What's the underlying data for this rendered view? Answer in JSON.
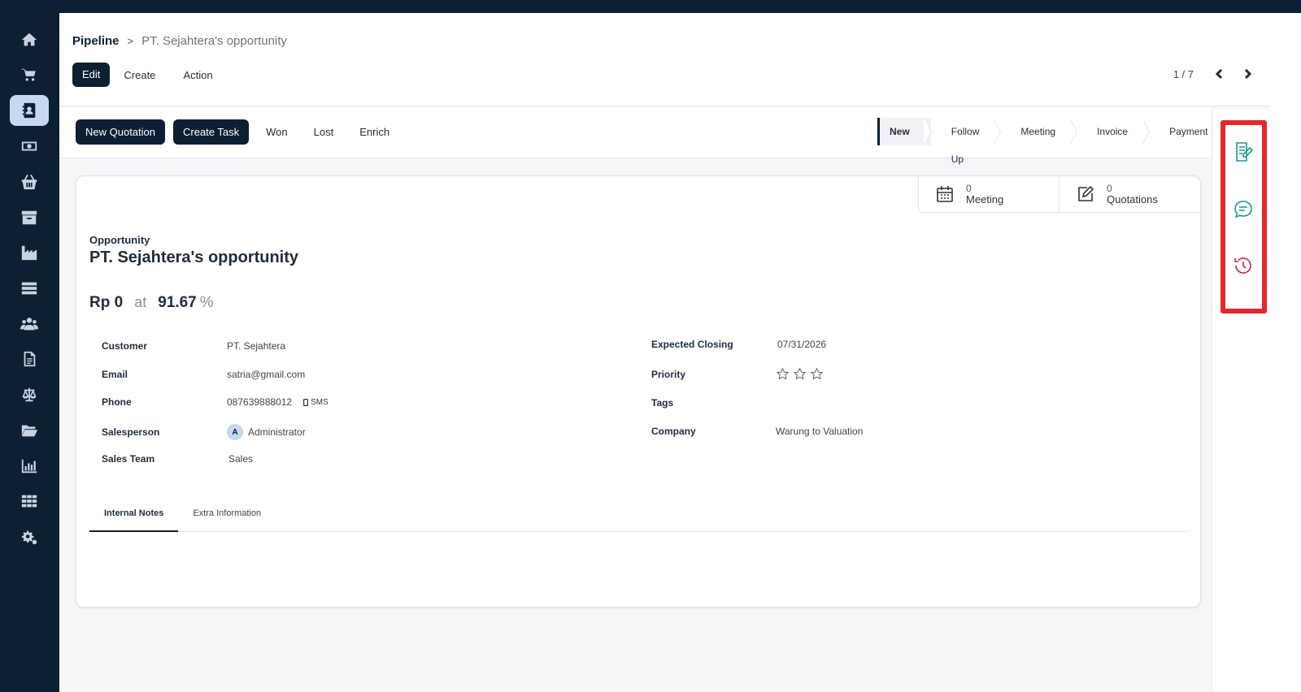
{
  "sidebar": {
    "items": [
      {
        "name": "home-icon"
      },
      {
        "name": "cart-icon"
      },
      {
        "name": "contacts-icon",
        "active": true
      },
      {
        "name": "money-icon"
      },
      {
        "name": "basket-icon"
      },
      {
        "name": "archive-icon"
      },
      {
        "name": "factory-icon"
      },
      {
        "name": "server-icon"
      },
      {
        "name": "users-icon"
      },
      {
        "name": "document-icon"
      },
      {
        "name": "balance-scale-icon"
      },
      {
        "name": "folder-open-icon"
      },
      {
        "name": "bar-chart-icon"
      },
      {
        "name": "apps-grid-icon"
      },
      {
        "name": "settings-gears-icon"
      }
    ]
  },
  "breadcrumb": {
    "root": "Pipeline",
    "separator": ">",
    "current": "PT. Sejahtera's opportunity"
  },
  "control_panel": {
    "edit_label": "Edit",
    "create_label": "Create",
    "action_label": "Action",
    "pager": "1 / 7"
  },
  "status_actions": {
    "new_quotation": "New Quotation",
    "create_task": "Create Task",
    "won": "Won",
    "lost": "Lost",
    "enrich": "Enrich"
  },
  "stages": [
    "New",
    "Follow Up",
    "Meeting",
    "Invoice",
    "Payment"
  ],
  "active_stage": "New",
  "smart_buttons": {
    "meeting": {
      "count": "0",
      "label": "Meeting"
    },
    "quotations": {
      "count": "0",
      "label": "Quotations"
    }
  },
  "form": {
    "type_label": "Opportunity",
    "title": "PT. Sejahtera's opportunity",
    "revenue": "Rp 0",
    "at": "at",
    "probability": "91.67",
    "pct": "%",
    "left": {
      "customer_label": "Customer",
      "customer": "PT. Sejahtera",
      "email_label": "Email",
      "email": "satria@gmail.com",
      "phone_label": "Phone",
      "phone": "087639888012",
      "sms": "SMS",
      "salesperson_label": "Salesperson",
      "salesperson": "Administrator",
      "salesperson_initial": "A",
      "sales_team_label": "Sales Team",
      "sales_team": "Sales"
    },
    "right": {
      "expected_closing_label": "Expected Closing",
      "expected_closing": "07/31/2026",
      "priority_label": "Priority",
      "priority_stars": 0,
      "tags_label": "Tags",
      "company_label": "Company",
      "company": "Warung to Valuation"
    },
    "tabs": [
      "Internal Notes",
      "Extra Information"
    ],
    "active_tab": "Internal Notes"
  },
  "chatter_rail": {
    "icons": [
      "log-note-icon",
      "message-icon",
      "activity-clock-icon"
    ],
    "colors": {
      "note": "#1a9b8c",
      "message": "#1a9b8c",
      "activity": "#c4234a",
      "highlight": "#e5262f"
    }
  }
}
